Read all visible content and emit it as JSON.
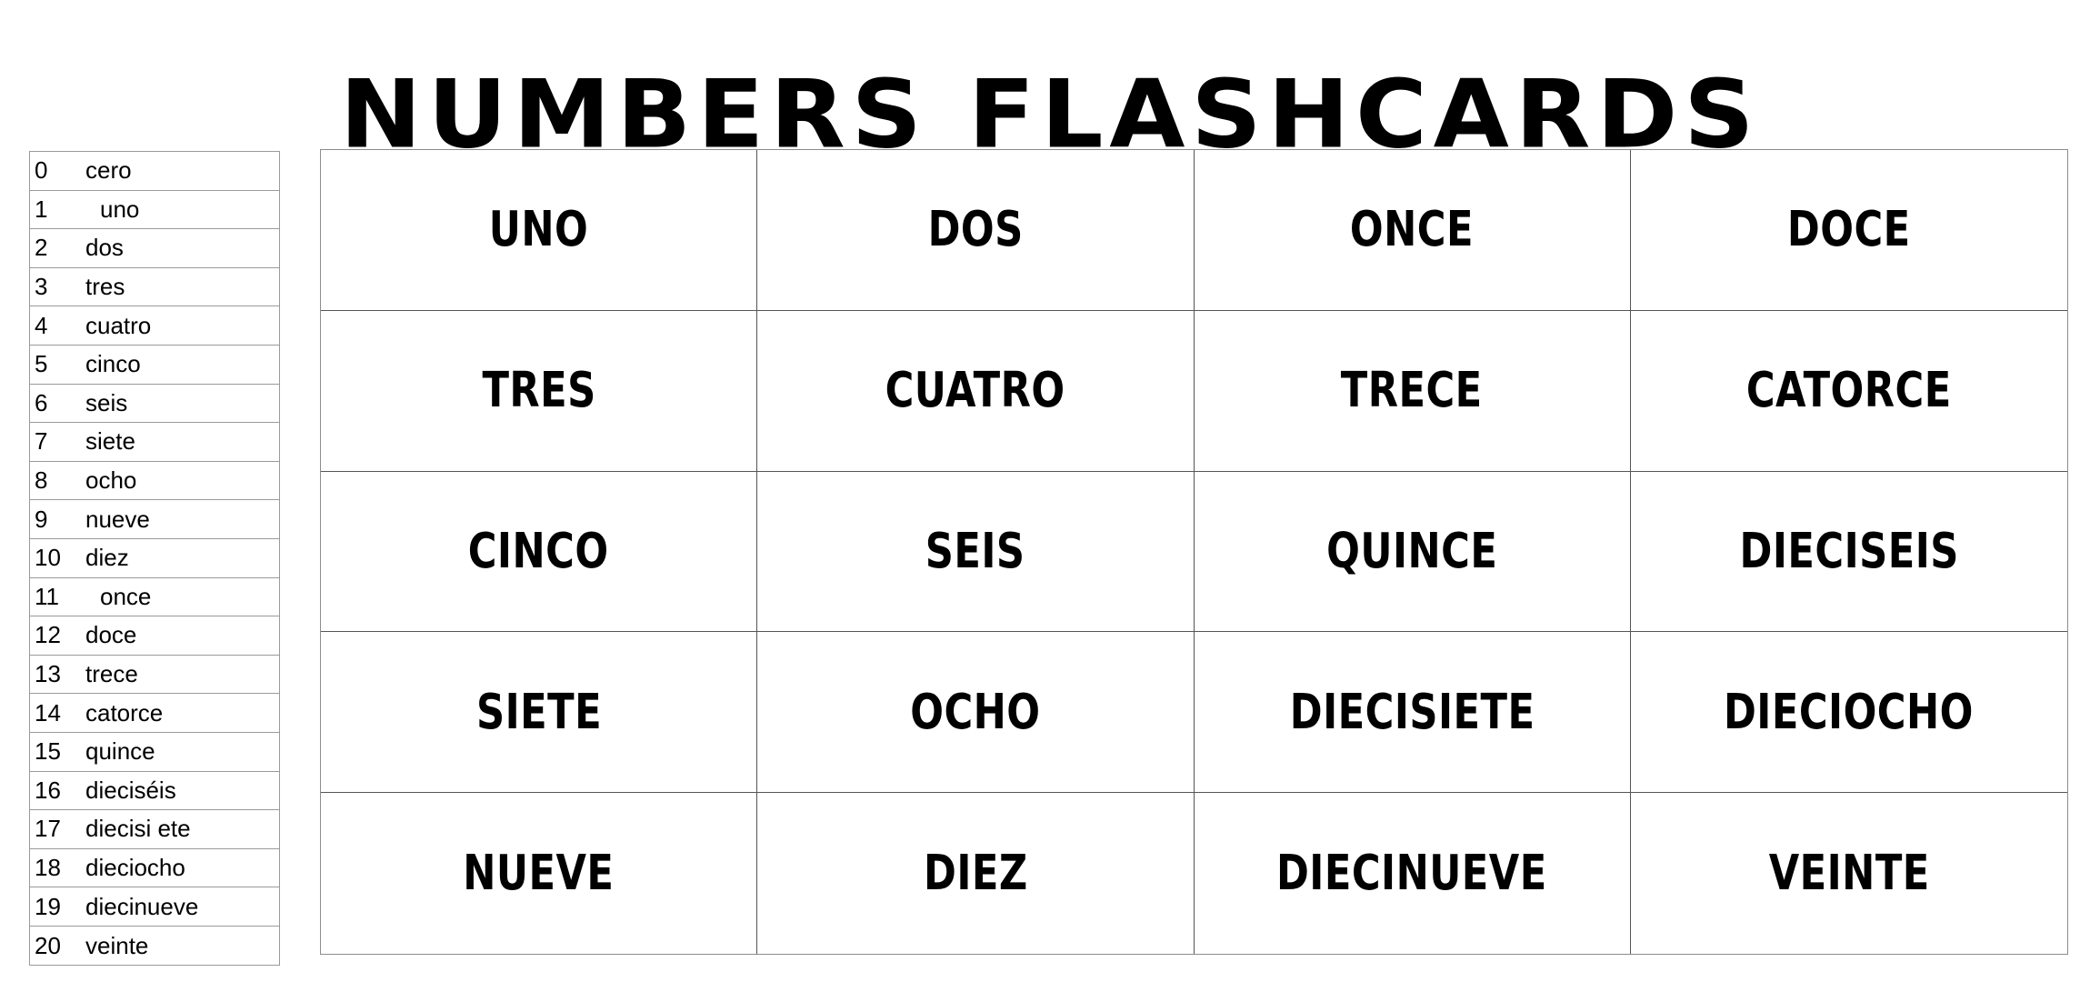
{
  "document": {
    "title": "NUMBERS FLASHCARDS"
  },
  "reference_list": {
    "rows": [
      {
        "number": "0",
        "word": "cero",
        "indented": false
      },
      {
        "number": "1",
        "word": "uno",
        "indented": true
      },
      {
        "number": "2",
        "word": "dos",
        "indented": false
      },
      {
        "number": "3",
        "word": "tres",
        "indented": false
      },
      {
        "number": "4",
        "word": "cuatro",
        "indented": false
      },
      {
        "number": "5",
        "word": "cinco",
        "indented": false
      },
      {
        "number": "6",
        "word": "seis",
        "indented": false
      },
      {
        "number": "7",
        "word": "siete",
        "indented": false
      },
      {
        "number": "8",
        "word": "ocho",
        "indented": false
      },
      {
        "number": "9",
        "word": "nueve",
        "indented": false
      },
      {
        "number": "10",
        "word": "diez",
        "indented": false
      },
      {
        "number": "11",
        "word": "once",
        "indented": true
      },
      {
        "number": "12",
        "word": "doce",
        "indented": false
      },
      {
        "number": "13",
        "word": "trece",
        "indented": false
      },
      {
        "number": "14",
        "word": "catorce",
        "indented": false
      },
      {
        "number": "15",
        "word": "quince",
        "indented": false
      },
      {
        "number": "16",
        "word": "dieciséis",
        "indented": false
      },
      {
        "number": "17",
        "word": "diecisi ete",
        "indented": false
      },
      {
        "number": "18",
        "word": "dieciocho",
        "indented": false
      },
      {
        "number": "19",
        "word": "diecinueve",
        "indented": false
      },
      {
        "number": "20",
        "word": "veinte",
        "indented": false
      }
    ]
  },
  "flashcards": {
    "columns": 4,
    "rows": 5,
    "cells": [
      {
        "word": "UNO"
      },
      {
        "word": "DOS"
      },
      {
        "word": "ONCE"
      },
      {
        "word": "DOCE"
      },
      {
        "word": "TRES"
      },
      {
        "word": "CUATRO"
      },
      {
        "word": "TRECE"
      },
      {
        "word": "CATORCE"
      },
      {
        "word": "CINCO"
      },
      {
        "word": "SEIS"
      },
      {
        "word": "QUINCE"
      },
      {
        "word": "DIECISEIS"
      },
      {
        "word": "SIETE"
      },
      {
        "word": "OCHO"
      },
      {
        "word": "DIECISIETE"
      },
      {
        "word": "DIECIOCHO"
      },
      {
        "word": "NUEVE"
      },
      {
        "word": "DIEZ"
      },
      {
        "word": "DIECINUEVE"
      },
      {
        "word": "VEINTE"
      }
    ]
  },
  "colors": {
    "background": "#ffffff",
    "text": "#000000",
    "grid_border": "#555555",
    "outer_border": "#8c8c8c",
    "list_border": "#9a9a9a"
  }
}
